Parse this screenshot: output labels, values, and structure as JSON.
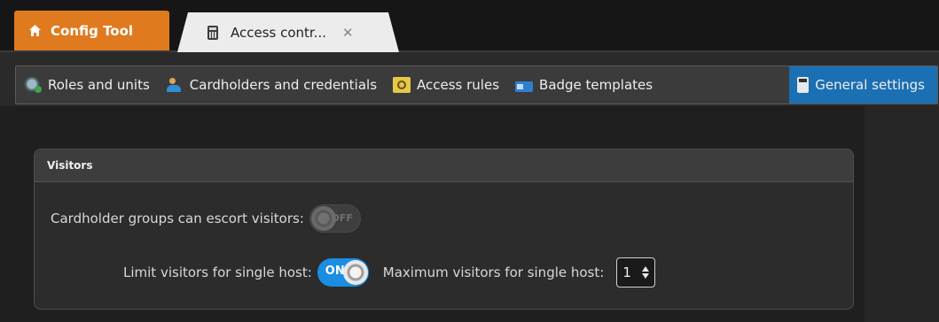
{
  "tabs": {
    "home_label": "Config Tool",
    "doc_label": "Access contr...",
    "close_glyph": "✕"
  },
  "toolbar": {
    "items": [
      {
        "label": "Roles and units",
        "icon": "roles-units-icon"
      },
      {
        "label": "Cardholders and credentials",
        "icon": "cardholder-icon"
      },
      {
        "label": "Access rules",
        "icon": "access-rules-icon"
      },
      {
        "label": "Badge templates",
        "icon": "badge-icon"
      },
      {
        "label": "General settings",
        "icon": "calculator-icon",
        "active": true
      }
    ]
  },
  "visitors": {
    "title": "Visitors",
    "escort_label": "Cardholder groups can escort visitors:",
    "escort_toggle": "OFF",
    "limit_label": "Limit visitors for single host:",
    "limit_toggle": "ON",
    "max_label": "Maximum visitors for single host:",
    "max_value": "1"
  },
  "colors": {
    "accent_home": "#e07a1f",
    "accent_active": "#1b6fb3",
    "toggle_on": "#1b8de3"
  }
}
